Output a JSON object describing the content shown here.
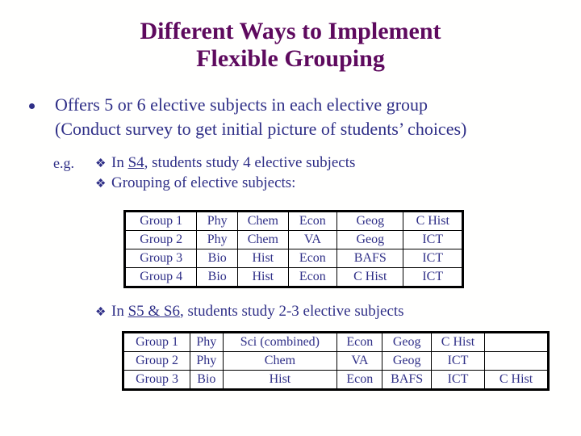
{
  "slide": {
    "title": {
      "line1": "Different Ways to Implement",
      "line2": "Flexible Grouping"
    },
    "colors": {
      "title": "#5e0a5e",
      "body": "#2f2f87",
      "background": "#fffffe",
      "table_border": "#000000"
    },
    "bullet_main": {
      "marker": "round-bullet",
      "line1": "Offers 5 or 6 elective subjects in each elective group",
      "line2": "(Conduct survey to get initial picture of students’ choices)"
    },
    "eg": {
      "label": "e.g.",
      "marker": "❖",
      "items": [
        {
          "prefix": "In ",
          "underlined": "S4",
          "suffix": ", students study 4 elective subjects"
        },
        {
          "prefix": "Grouping of elective subjects:",
          "underlined": "",
          "suffix": ""
        }
      ]
    },
    "s56": {
      "marker": "❖",
      "prefix": "In ",
      "underlined": "S5 & S6",
      "suffix": ", students study 2-3 elective subjects"
    },
    "table_s4": {
      "rows": [
        [
          "Group 1",
          "Phy",
          "Chem",
          "Econ",
          "Geog",
          "C Hist"
        ],
        [
          "Group 2",
          "Phy",
          "Chem",
          "VA",
          "Geog",
          "ICT"
        ],
        [
          "Group 3",
          "Bio",
          "Hist",
          "Econ",
          "BAFS",
          "ICT"
        ],
        [
          "Group 4",
          "Bio",
          "Hist",
          "Econ",
          "C Hist",
          "ICT"
        ]
      ]
    },
    "table_s56": {
      "rows": [
        [
          "Group 1",
          "Phy",
          "Sci (combined)",
          "Econ",
          "Geog",
          "C Hist",
          ""
        ],
        [
          "Group 2",
          "Phy",
          "Chem",
          "VA",
          "Geog",
          "ICT",
          ""
        ],
        [
          "Group 3",
          "Bio",
          "Hist",
          "Econ",
          "BAFS",
          "ICT",
          "C Hist"
        ]
      ]
    }
  }
}
